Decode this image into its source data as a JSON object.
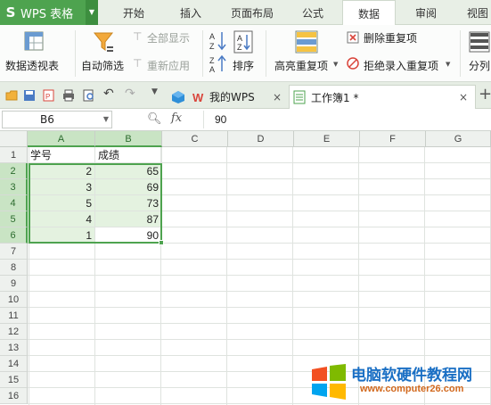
{
  "app": {
    "title": "WPS 表格",
    "logo": "S"
  },
  "menu": {
    "tabs": [
      "开始",
      "插入",
      "页面布局",
      "公式",
      "数据",
      "审阅",
      "视图"
    ],
    "active": "数据"
  },
  "ribbon": {
    "pivot_table": "数据透视表",
    "auto_filter": "自动筛选",
    "show_all": "全部显示",
    "reapply": "重新应用",
    "sort": "排序",
    "highlight_duplicates": "高亮重复项",
    "remove_duplicates": "删除重复项",
    "reject_duplicates": "拒绝录入重复项",
    "split": "分列"
  },
  "doc_tabs": [
    {
      "label": "我的WPS",
      "active": false
    },
    {
      "label": "工作簿1 *",
      "active": true
    }
  ],
  "formula_bar": {
    "cell_ref": "B6",
    "fx": "fx",
    "value": "90"
  },
  "sheet": {
    "columns": [
      "A",
      "B",
      "C",
      "D",
      "E",
      "F",
      "G"
    ],
    "rows": [
      "1",
      "2",
      "3",
      "4",
      "5",
      "6",
      "7",
      "8",
      "9",
      "10",
      "11",
      "12",
      "13",
      "14",
      "15",
      "16"
    ],
    "header": {
      "a1": "学号",
      "b1": "成绩"
    },
    "data": [
      {
        "id": "2",
        "score": "65"
      },
      {
        "id": "3",
        "score": "69"
      },
      {
        "id": "5",
        "score": "73"
      },
      {
        "id": "4",
        "score": "87"
      },
      {
        "id": "1",
        "score": "90"
      }
    ]
  },
  "watermark": {
    "title": "电脑软硬件教程网",
    "url": "www.computer26.com"
  },
  "colors": {
    "accent": "#4ea34f",
    "selection_fill": "#e4f2e0"
  }
}
